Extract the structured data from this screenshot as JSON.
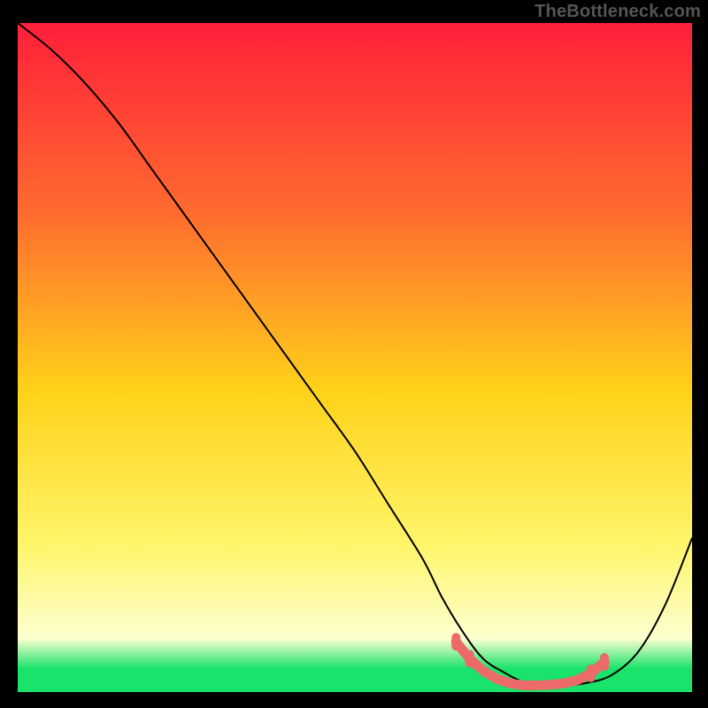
{
  "watermark": "TheBottleneck.com",
  "colors": {
    "gradient_top": "#ff1f3a",
    "gradient_mid_upper": "#ff6a2f",
    "gradient_mid": "#ffd21a",
    "gradient_lower": "#fff56a",
    "gradient_pale": "#fdffd0",
    "gradient_bottom": "#19e36a",
    "curve": "#000000",
    "marker": "#ed6a6a",
    "frame_bg": "#000000"
  },
  "chart_data": {
    "type": "line",
    "title": "",
    "xlabel": "",
    "ylabel": "",
    "xlim": [
      0,
      100
    ],
    "ylim": [
      0,
      100
    ],
    "grid": false,
    "legend": false,
    "series": [
      {
        "name": "bottleneck-curve",
        "x": [
          0,
          5,
          10,
          15,
          20,
          25,
          30,
          35,
          40,
          45,
          50,
          55,
          60,
          63,
          66,
          69,
          72,
          75,
          78,
          81,
          84,
          88,
          92,
          96,
          100
        ],
        "y": [
          100,
          96,
          91,
          85,
          78,
          71,
          64,
          57,
          50,
          43,
          36,
          28,
          20,
          14,
          9,
          5,
          3,
          1.5,
          1,
          1,
          1.3,
          2.5,
          6,
          13,
          23
        ]
      }
    ],
    "flat_segment": {
      "comment": "highlighted red markers near the valley floor",
      "x": [
        65,
        67,
        69,
        71,
        73,
        75,
        77,
        79,
        81,
        83,
        85,
        87
      ],
      "y": [
        7.5,
        5.0,
        3.2,
        2.0,
        1.3,
        1.0,
        1.0,
        1.1,
        1.3,
        1.8,
        2.8,
        4.5
      ]
    }
  }
}
